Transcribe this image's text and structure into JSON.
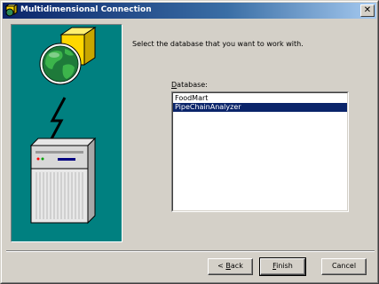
{
  "window": {
    "title": "Multidimensional Connection",
    "close_glyph": "✕"
  },
  "main": {
    "prompt": "Select the database that you want to work with.",
    "database_label_accel": "D",
    "database_label_rest": "atabase:",
    "databases": [
      {
        "name": "FoodMart",
        "selected": false
      },
      {
        "name": "PipeChainAnalyzer",
        "selected": true
      }
    ]
  },
  "buttons": {
    "back_prefix": "< ",
    "back_accel": "B",
    "back_rest": "ack",
    "finish_accel": "F",
    "finish_rest": "inish",
    "cancel": "Cancel"
  },
  "colors": {
    "title_gradient_start": "#0a246a",
    "title_gradient_end": "#a6caf0",
    "illustration_bg": "#008080",
    "selection": "#0a246a",
    "dialog_face": "#d4d0c8"
  },
  "icons": {
    "title": "connection-icon",
    "illustration": [
      "cube-icon",
      "globe-icon",
      "lightning-bolt-icon",
      "server-icon"
    ]
  }
}
